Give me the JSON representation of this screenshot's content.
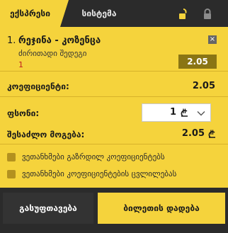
{
  "tabs": {
    "active_label": "ექსპრესი",
    "inactive_label": "სისტემა"
  },
  "header_icons": {
    "left": "lock-open-icon",
    "right": "lock-closed-icon"
  },
  "selection": {
    "number": "1.",
    "title": "რეჯინა - კოზენცა",
    "market": "ძირითადი შედეგი",
    "outcome": "1",
    "odds": "2.05"
  },
  "coefficient": {
    "label": "კოეფიციენტი:",
    "value": "2.05"
  },
  "stake": {
    "label": "ფსონი:",
    "value": "1"
  },
  "potential_win": {
    "label": "შესაძლო მოგება:",
    "value": "2.05"
  },
  "options": [
    {
      "label": "ვეთანხმები გაზრდილ კოეფიციენტებს"
    },
    {
      "label": "ვეთანხმები კოეფიციენტების ცვლილებას"
    }
  ],
  "buttons": {
    "clear": "გასუფთავება",
    "place_bet": "ბილეთის დადება"
  },
  "colors": {
    "accent": "#f5d33c",
    "dark": "#2b2b2b",
    "odds_bg": "#8a7514",
    "outcome_text": "#c21f1f"
  }
}
